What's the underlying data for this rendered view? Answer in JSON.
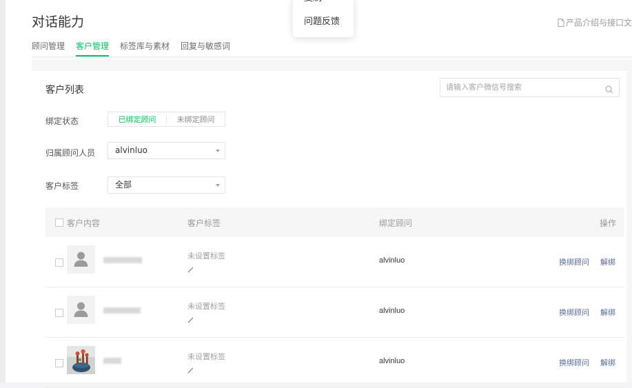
{
  "page": {
    "title": "对话能力",
    "doc_link": "产品介绍与接口文"
  },
  "tabs": [
    {
      "label": "顾问管理",
      "active": false
    },
    {
      "label": "客户管理",
      "active": true
    },
    {
      "label": "标签库与素材",
      "active": false
    },
    {
      "label": "回复与敏感词",
      "active": false
    }
  ],
  "popover": {
    "items": [
      "复制",
      "问题反馈"
    ]
  },
  "customer_list": {
    "title": "客户列表",
    "search_placeholder": "请输入客户微信号搜索",
    "filters": {
      "binding_status": {
        "label": "绑定状态",
        "options": [
          "已绑定顾问",
          "未绑定顾问"
        ],
        "selected": "已绑定顾问"
      },
      "advisor": {
        "label": "归属顾问人员",
        "value": "alvinluo"
      },
      "customer_tag": {
        "label": "客户标签",
        "value": "全部"
      }
    },
    "columns": [
      "客户内容",
      "客户标签",
      "绑定顾问",
      "操作"
    ],
    "rows": [
      {
        "avatar": "default-person",
        "tag": "未设置标签",
        "advisor": "alvinluo",
        "actions": [
          "换绑顾问",
          "解绑"
        ]
      },
      {
        "avatar": "default-person",
        "tag": "未设置标签",
        "advisor": "alvinluo",
        "actions": [
          "换绑顾问",
          "解绑"
        ]
      },
      {
        "avatar": "photo",
        "tag": "未设置标签",
        "advisor": "alvinluo",
        "actions": [
          "换绑顾问",
          "解绑"
        ]
      }
    ]
  },
  "colors": {
    "accent": "#07c160",
    "link": "#576b95"
  }
}
